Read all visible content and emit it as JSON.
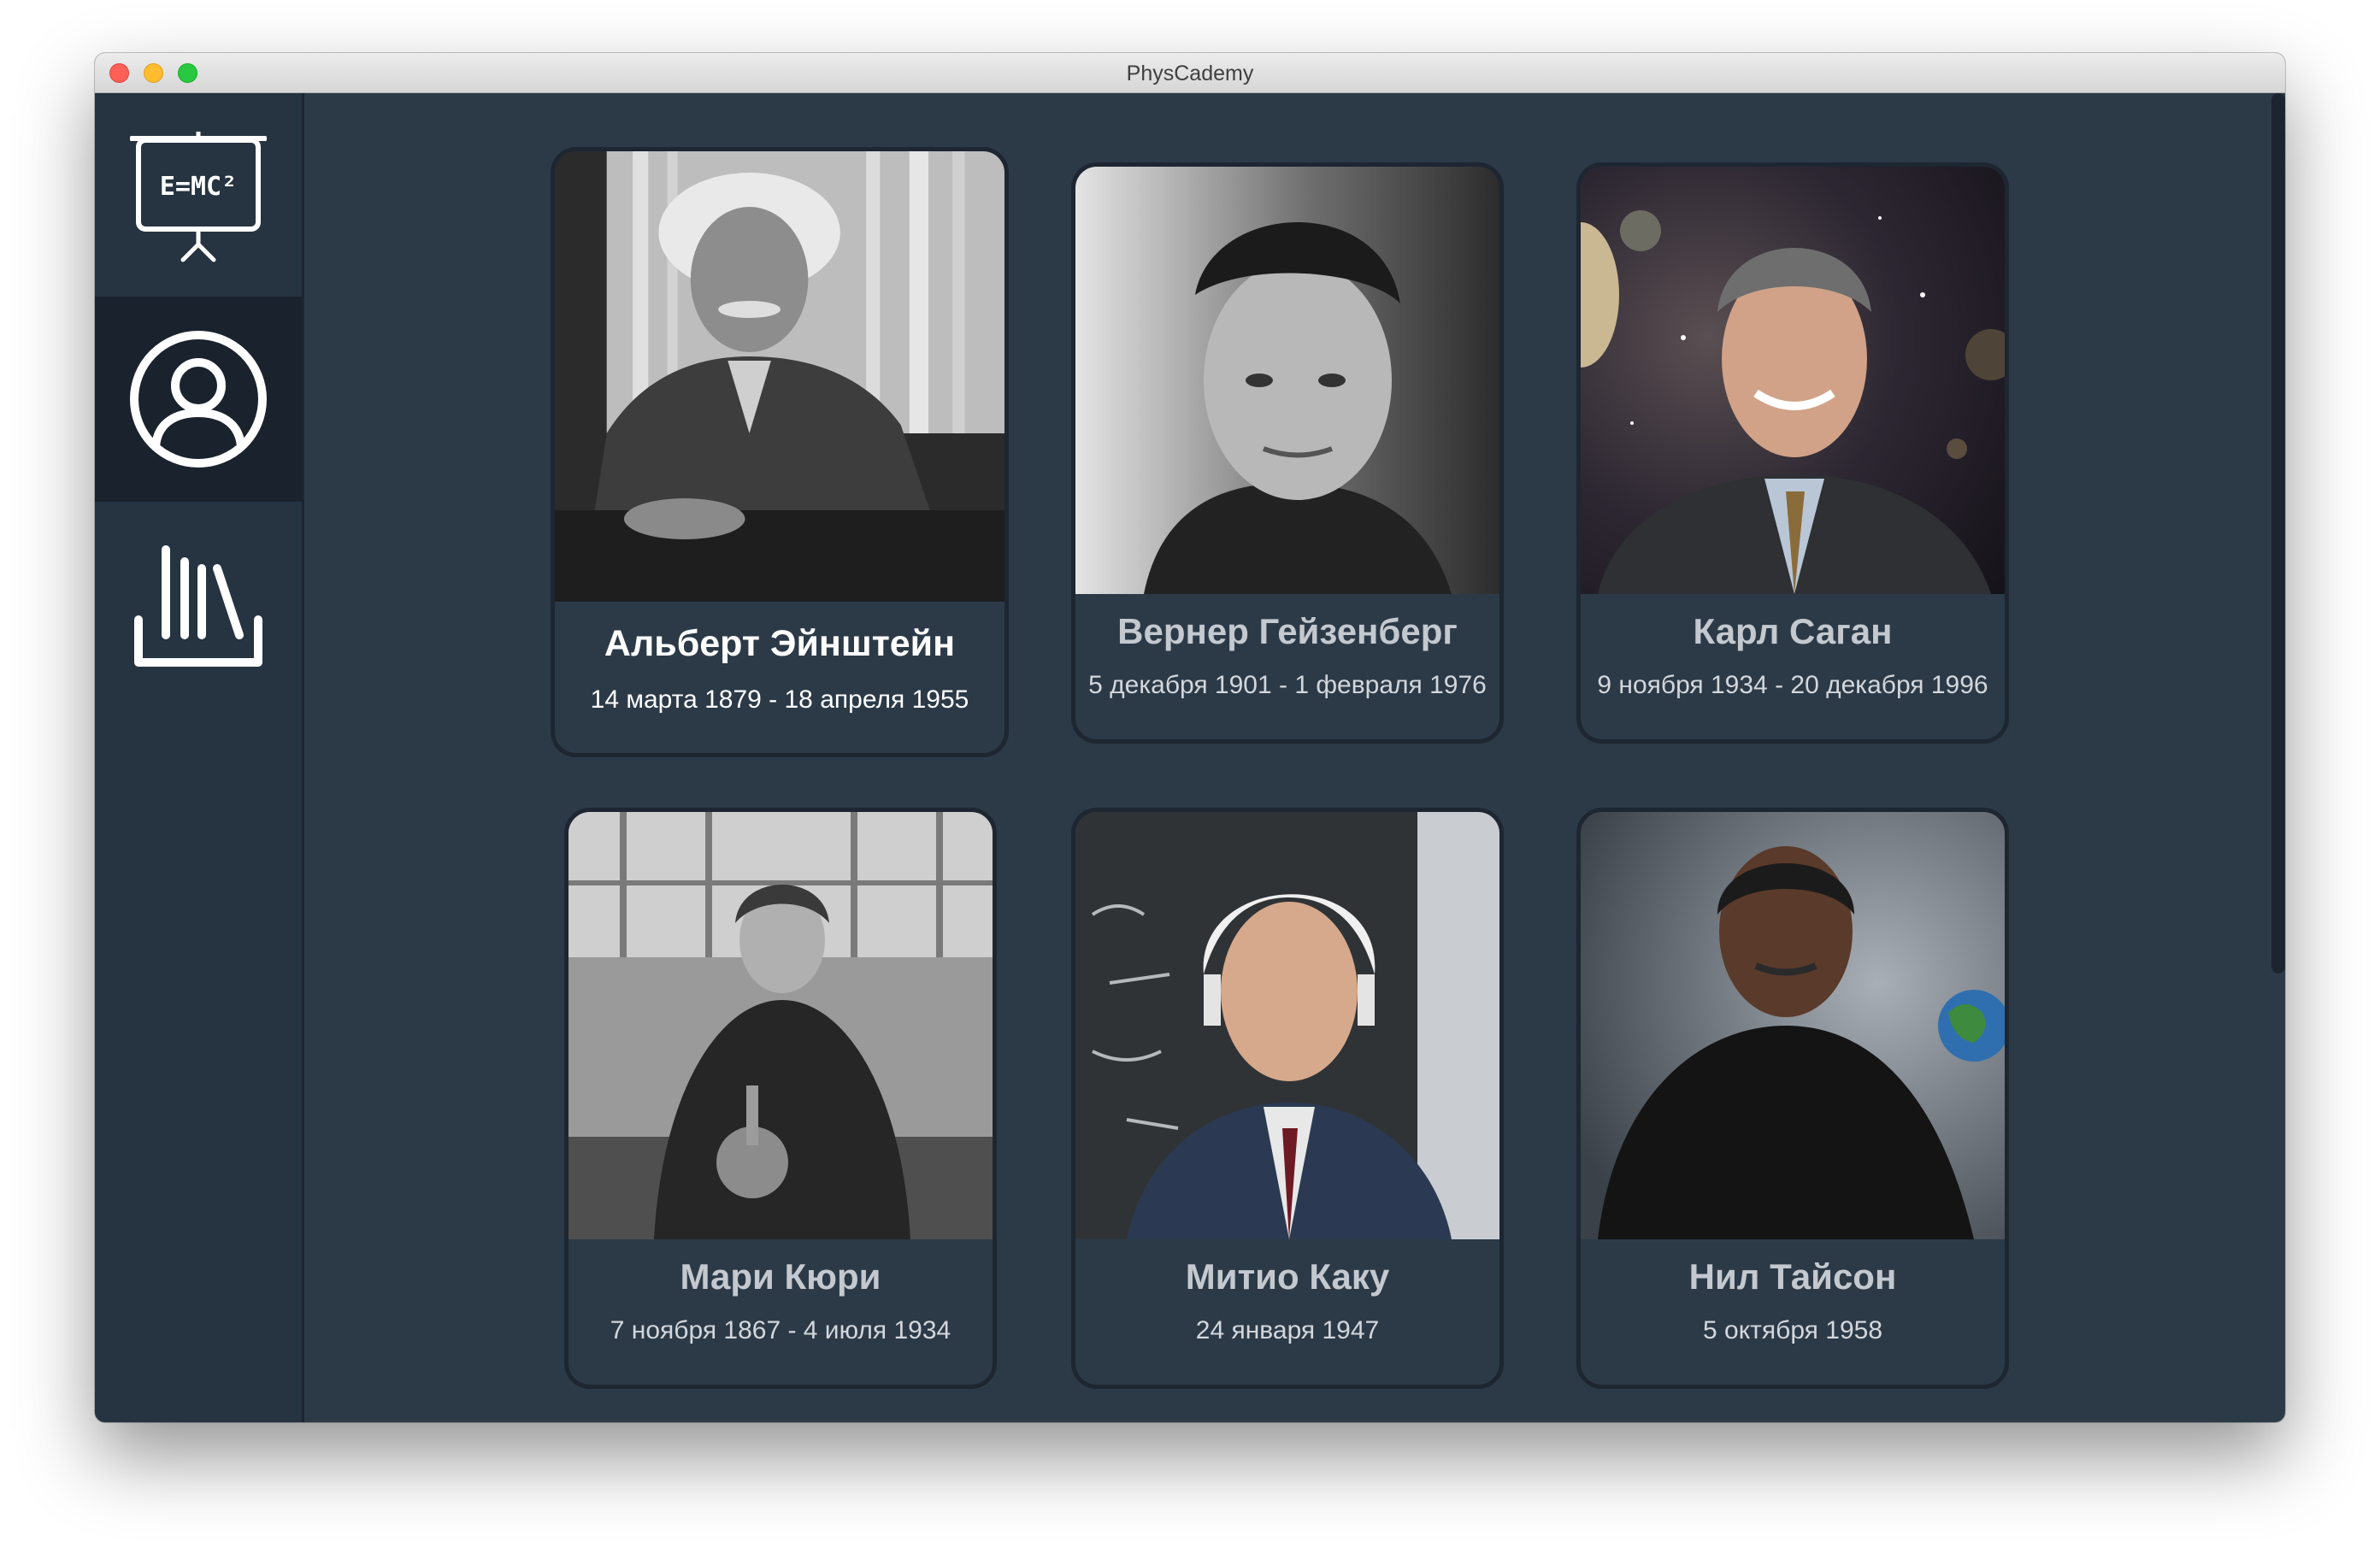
{
  "window": {
    "title": "PhysCademy"
  },
  "sidebar": {
    "logo": {
      "icon": "chalkboard-emc2-icon",
      "text": "E=MC²"
    },
    "items": [
      {
        "icon": "user-circle-icon",
        "active": true
      },
      {
        "icon": "library-books-icon",
        "active": false
      }
    ]
  },
  "cards": [
    {
      "name": "Альберт Эйнштейн",
      "dates": "14 марта 1879 - 18 апреля 1955",
      "photo": "portrait-photo"
    },
    {
      "name": "Вернер Гейзенберг",
      "dates": "5 декабря 1901 - 1 февраля 1976",
      "photo": "portrait-photo"
    },
    {
      "name": "Карл Саган",
      "dates": "9 ноября 1934 - 20 декабря 1996",
      "photo": "portrait-photo"
    },
    {
      "name": "Мари Кюри",
      "dates": "7 ноября 1867 - 4 июля 1934",
      "photo": "portrait-photo"
    },
    {
      "name": "Митио Каку",
      "dates": "24 января 1947",
      "photo": "portrait-photo"
    },
    {
      "name": "Нил Тайсон",
      "dates": "5 октября 1958",
      "photo": "portrait-photo"
    }
  ],
  "colors": {
    "window_bg": "#2c3a48",
    "sidebar_bg": "#263340",
    "sidebar_active_bg": "#1a232d",
    "card_border": "#1d2631",
    "name_text": "#c4c9cf",
    "dates_text": "#d3d7dc"
  }
}
